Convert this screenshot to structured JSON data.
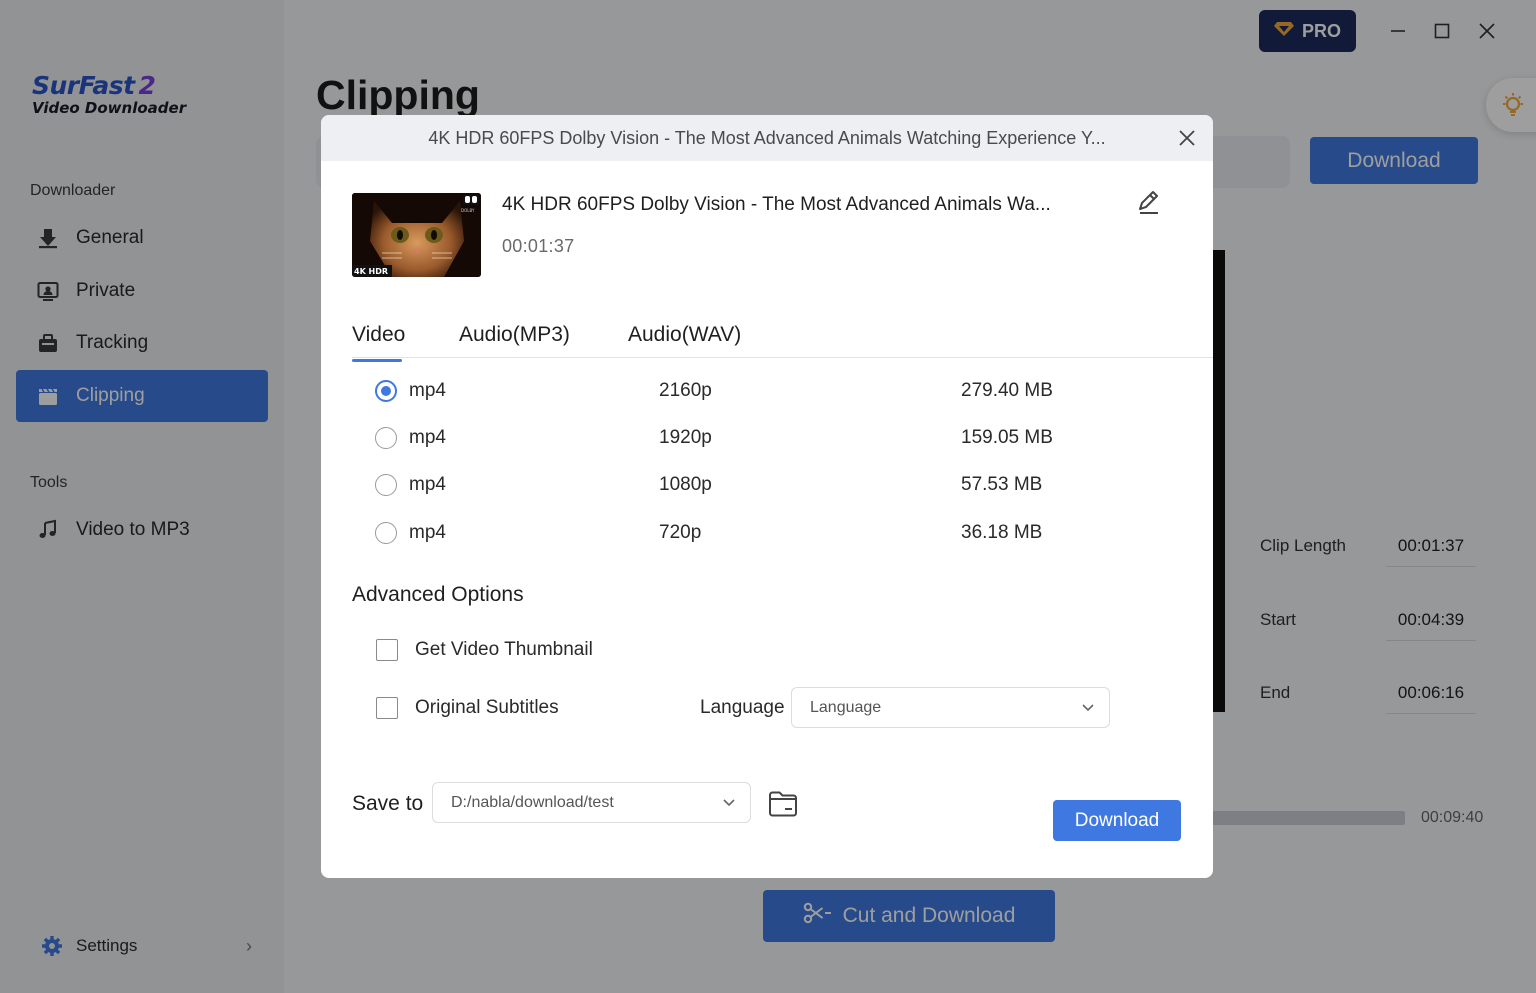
{
  "app": {
    "logo_main": "SurFast",
    "logo_version": "2",
    "logo_sub": "Video Downloader"
  },
  "sidebar": {
    "downloader_title": "Downloader",
    "items": [
      {
        "label": "General",
        "icon": "download-arrow-icon"
      },
      {
        "label": "Private",
        "icon": "private-icon"
      },
      {
        "label": "Tracking",
        "icon": "tracking-icon"
      },
      {
        "label": "Clipping",
        "icon": "clipping-icon",
        "active": true
      }
    ],
    "tools_title": "Tools",
    "tools": [
      {
        "label": "Video to MP3",
        "icon": "music-note-icon"
      }
    ],
    "settings_label": "Settings"
  },
  "header": {
    "pro_label": "PRO"
  },
  "main": {
    "title": "Clipping",
    "download_label": "Download",
    "clip_length_label": "Clip Length",
    "clip_length_value": "00:01:37",
    "start_label": "Start",
    "start_value": "00:04:39",
    "end_label": "End",
    "end_value": "00:06:16",
    "total_time": "00:09:40",
    "cut_button_label": "Cut and Download"
  },
  "modal": {
    "header_title": "4K HDR 60FPS Dolby Vision - The Most Advanced Animals Watching Experience Y...",
    "video_title": "4K HDR 60FPS Dolby Vision - The Most Advanced Animals Wa...",
    "duration": "00:01:37",
    "thumb_badge": "4K HDR",
    "thumb_brand": "DOLBY",
    "tabs": [
      "Video",
      "Audio(MP3)",
      "Audio(WAV)"
    ],
    "active_tab": "Video",
    "formats": [
      {
        "ext": "mp4",
        "resolution": "2160p",
        "size": "279.40 MB",
        "selected": true
      },
      {
        "ext": "mp4",
        "resolution": "1920p",
        "size": "159.05 MB",
        "selected": false
      },
      {
        "ext": "mp4",
        "resolution": "1080p",
        "size": "57.53 MB",
        "selected": false
      },
      {
        "ext": "mp4",
        "resolution": "720p",
        "size": "36.18 MB",
        "selected": false
      }
    ],
    "advanced_title": "Advanced Options",
    "thumbnail_option": "Get Video Thumbnail",
    "subtitles_option": "Original Subtitles",
    "language_label": "Language",
    "language_placeholder": "Language",
    "save_to_label": "Save to",
    "save_path": "D:/nabla/download/test",
    "download_label": "Download"
  },
  "colors": {
    "accent": "#3f78e0",
    "pro_bg": "#1c2b5c",
    "sidebar_bg": "#ebedf1"
  }
}
